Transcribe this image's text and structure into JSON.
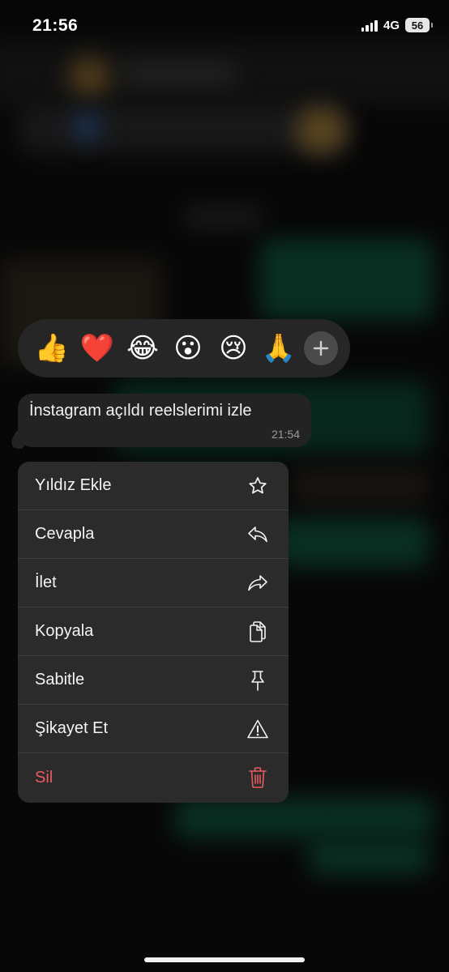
{
  "status_bar": {
    "time": "21:56",
    "network": "4G",
    "battery": "56"
  },
  "reactions": {
    "emojis": [
      "👍",
      "❤️",
      "😂",
      "😮",
      "😢",
      "🙏"
    ],
    "plus_icon": "plus-icon"
  },
  "message": {
    "text": "İnstagram açıldı reelslerimi izle",
    "time": "21:54"
  },
  "menu": {
    "items": [
      {
        "label": "Yıldız Ekle",
        "icon": "star-icon"
      },
      {
        "label": "Cevapla",
        "icon": "reply-icon"
      },
      {
        "label": "İlet",
        "icon": "forward-icon"
      },
      {
        "label": "Kopyala",
        "icon": "copy-icon"
      },
      {
        "label": "Sabitle",
        "icon": "pin-icon"
      },
      {
        "label": "Şikayet Et",
        "icon": "warning-icon"
      },
      {
        "label": "Sil",
        "icon": "trash-icon",
        "color": "#e95b5f"
      }
    ]
  },
  "colors": {
    "menu_bg": "#2b2b2b",
    "bubble_bg": "#232323",
    "danger": "#e95b5f",
    "incoming_bubble_green": "#0f4a36"
  }
}
